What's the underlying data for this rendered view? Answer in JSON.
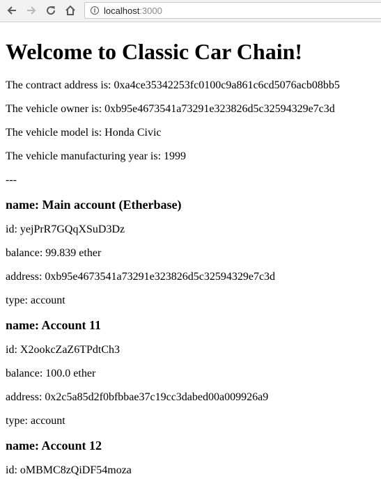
{
  "browser": {
    "url_host": "localhost",
    "url_port": ":3000"
  },
  "page": {
    "title": "Welcome to Classic Car Chain!",
    "contract_line": "The contract address is: 0xa4ce35342253fc0100c9a861c6cd5076acb08bb5",
    "owner_line": "The vehicle owner is: 0xb95e4673541a73291e323826d5c32594329e7c3d",
    "model_line": "The vehicle model is: Honda Civic",
    "year_line": "The vehicle manufacturing year is: 1999",
    "separator": "---"
  },
  "accounts": [
    {
      "name": "name: Main account (Etherbase)",
      "id": "id: yejPrR7GQqXSuD3Dz",
      "balance": "balance: 99.839 ether",
      "address": "address: 0xb95e4673541a73291e323826d5c32594329e7c3d",
      "type": "type: account"
    },
    {
      "name": "name: Account 11",
      "id": "id: X2ookcZaZ6TPdtCh3",
      "balance": "balance: 100.0 ether",
      "address": "address: 0x2c5a85d2f0bfbbae37c19cc3dabed00a009926a9",
      "type": "type: account"
    },
    {
      "name": "name: Account 12",
      "id": "id: oMBMC8zQiDF54moza"
    }
  ]
}
